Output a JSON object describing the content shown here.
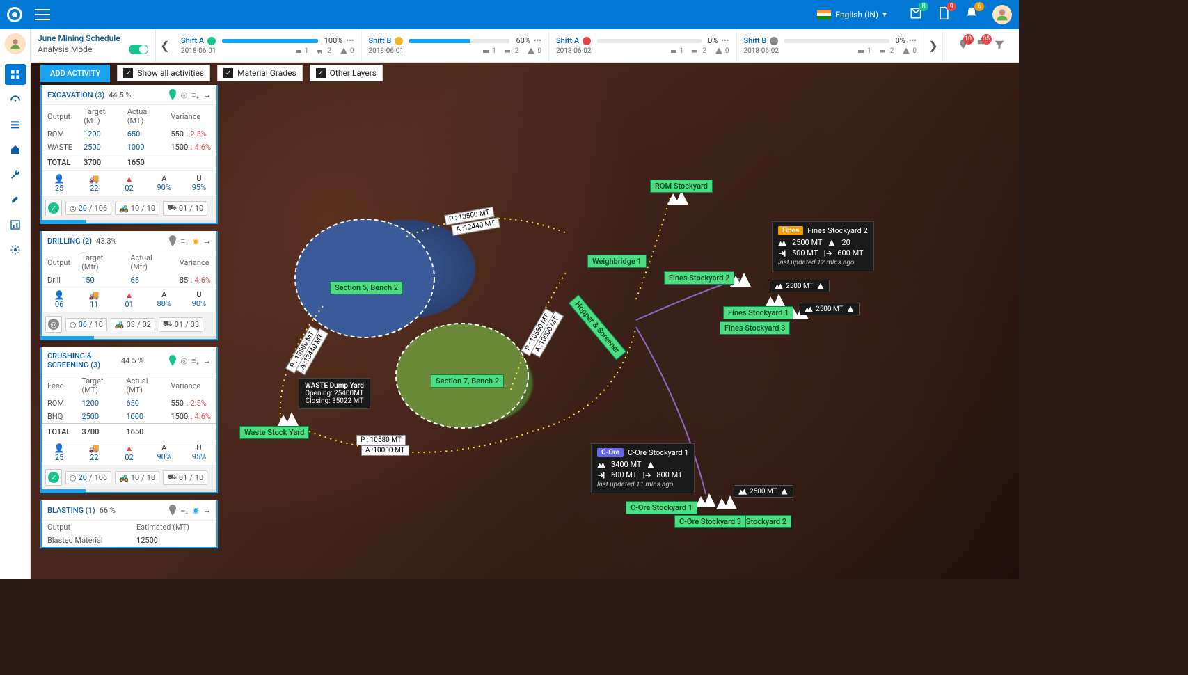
{
  "header": {
    "language": "English (IN)",
    "badges": {
      "mail": "8",
      "doc": "9",
      "bell": "6"
    }
  },
  "schedule": {
    "title": "June Mining Schedule",
    "mode": "Analysis Mode"
  },
  "shifts": [
    {
      "name": "Shift A",
      "date": "2018-06-01",
      "pct": "100%",
      "barPct": 100,
      "status": "#18c28f",
      "v1": "1",
      "v2": "2",
      "v3": "0"
    },
    {
      "name": "Shift B",
      "date": "2018-06-01",
      "pct": "60%",
      "barPct": 60,
      "status": "#f0b429",
      "v1": "1",
      "v2": "2",
      "v3": "0"
    },
    {
      "name": "Shift A",
      "date": "2018-06-02",
      "pct": "0%",
      "barPct": 0,
      "status": "#e64545",
      "v1": "1",
      "v2": "2",
      "v3": "0"
    },
    {
      "name": "Shift B",
      "date": "2018-06-02",
      "pct": "0%",
      "barPct": 0,
      "status": "#888",
      "v1": "1",
      "v2": "2",
      "v3": "0"
    }
  ],
  "alerts": {
    "a1": "10",
    "a2": "05"
  },
  "controls": {
    "add": "ADD ACTIVITY",
    "c1": "Show all activities",
    "c2": "Material Grades",
    "c3": "Other Layers"
  },
  "cards": {
    "excavation": {
      "title": "EXCAVATION (3)",
      "pct": "44.5 %",
      "pinColor": "#18c28f",
      "th": [
        "Output",
        "Target (MT)",
        "Actual (MT)",
        "Variance"
      ],
      "rows": [
        {
          "lbl": "ROM",
          "t": "1200",
          "a": "650",
          "v": "550",
          "vp": "2.5%"
        },
        {
          "lbl": "WASTE",
          "t": "2500",
          "a": "1000",
          "v": "1500",
          "vp": "4.6%"
        }
      ],
      "total": {
        "lbl": "TOTAL",
        "t": "3700",
        "a": "1650"
      },
      "stats": [
        {
          "ic": "person",
          "v": "25"
        },
        {
          "ic": "truck",
          "v": "22"
        },
        {
          "ic": "alert",
          "v": "02"
        },
        {
          "lab": "A",
          "v": "90%"
        },
        {
          "lab": "U",
          "v": "95%"
        }
      ],
      "chips": {
        "leadColor": "#18c28f",
        "c1a": "20",
        "c1b": "106",
        "c2a": "10",
        "c2b": "10",
        "c3a": "01",
        "c3b": "10"
      },
      "prog": 25
    },
    "drilling": {
      "title": "DRILLING (2)",
      "pct": "43.3%",
      "pinColor": "#888",
      "th": [
        "Output",
        "Target (Mtr)",
        "Actual (Mtr)",
        "Variance"
      ],
      "rows": [
        {
          "lbl": "Drill",
          "t": "150",
          "a": "65",
          "v": "85",
          "vp": "4.6%"
        }
      ],
      "stats": [
        {
          "ic": "person",
          "v": "06"
        },
        {
          "ic": "truck",
          "v": "11"
        },
        {
          "ic": "alert",
          "v": "01"
        },
        {
          "lab": "A",
          "v": "88%"
        },
        {
          "lab": "U",
          "v": "90%"
        }
      ],
      "chips": {
        "leadColor": "#888",
        "badge": "#f59e0b",
        "c1a": "06",
        "c1b": "10",
        "c2a": "03",
        "c2b": "02",
        "c3a": "01",
        "c3b": "03"
      },
      "prog": 30
    },
    "crushing": {
      "title": "CRUSHING & SCREENING (3)",
      "pct": "44.5 %",
      "pinColor": "#18c28f",
      "th": [
        "Feed",
        "Target (MT)",
        "Actual (MT)",
        "Variance"
      ],
      "rows": [
        {
          "lbl": "ROM",
          "t": "1200",
          "a": "650",
          "v": "550",
          "vp": "2.5%"
        },
        {
          "lbl": "BHQ",
          "t": "2500",
          "a": "1000",
          "v": "1500",
          "vp": "4.6%"
        }
      ],
      "total": {
        "lbl": "TOTAL",
        "t": "3700",
        "a": "1650"
      },
      "stats": [
        {
          "ic": "person",
          "v": "25"
        },
        {
          "ic": "truck",
          "v": "22"
        },
        {
          "ic": "alert",
          "v": "02"
        },
        {
          "lab": "A",
          "v": "90%"
        },
        {
          "lab": "U",
          "v": "95%"
        }
      ],
      "chips": {
        "leadColor": "#18c28f",
        "c1a": "20",
        "c1b": "106",
        "c2a": "10",
        "c2b": "10",
        "c3a": "01",
        "c3b": "10"
      },
      "prog": 25
    },
    "blasting": {
      "title": "BLASTING (1)",
      "pct": "66 %",
      "pinColor": "#888",
      "th2": [
        "Output",
        "Estimated (MT)"
      ],
      "row2": {
        "lbl": "Blasted Material",
        "v": "12500"
      }
    }
  },
  "map": {
    "section5": "Section 5, Bench 2",
    "section7": "Section 7, Bench 2",
    "wasteYard": "Waste Stock Yard",
    "romYard": "ROM Stockyard",
    "weigh": "Weighbridge 1",
    "hopper": "Hopper & Screener",
    "fines1": "Fines Stockyard 1",
    "fines2": "Fines Stockyard 2",
    "fines3": "Fines Stockyard 3",
    "core1": "C-Ore Stockyard 1",
    "core2": "C-Ore Stockyard 2",
    "core3": "C-Ore Stockyard 3",
    "dump": {
      "t": "WASTE Dump Yard",
      "o": "Opening: 25400MT",
      "c": "Closing: 35022 MT"
    },
    "paths": {
      "p1": "P : 13500 MT",
      "a1": "A :12440 MT",
      "p2": "P : 15500 MT",
      "a2": "A :13440 MT",
      "p3": "P : 10580 MT",
      "a3": "A :10000 MT",
      "p4": "P : 10580 MT",
      "a4": "A :10000 MT"
    },
    "chips": {
      "val": "2500 MT"
    },
    "popFines": {
      "tag": "Fines",
      "tagColor": "#f59e0b",
      "title": "Fines Stockyard 2",
      "mt": "2500 MT",
      "loads": "20",
      "in": "500 MT",
      "out": "600 MT",
      "upd": "last updated 12 mins ago"
    },
    "popCore": {
      "tag": "C-Ore",
      "tagColor": "#6366f1",
      "title": "C-Ore Stockyard 1",
      "mt": "3400 MT",
      "in": "600 MT",
      "out": "800 MT",
      "upd": "last updated 11 mins ago"
    }
  }
}
